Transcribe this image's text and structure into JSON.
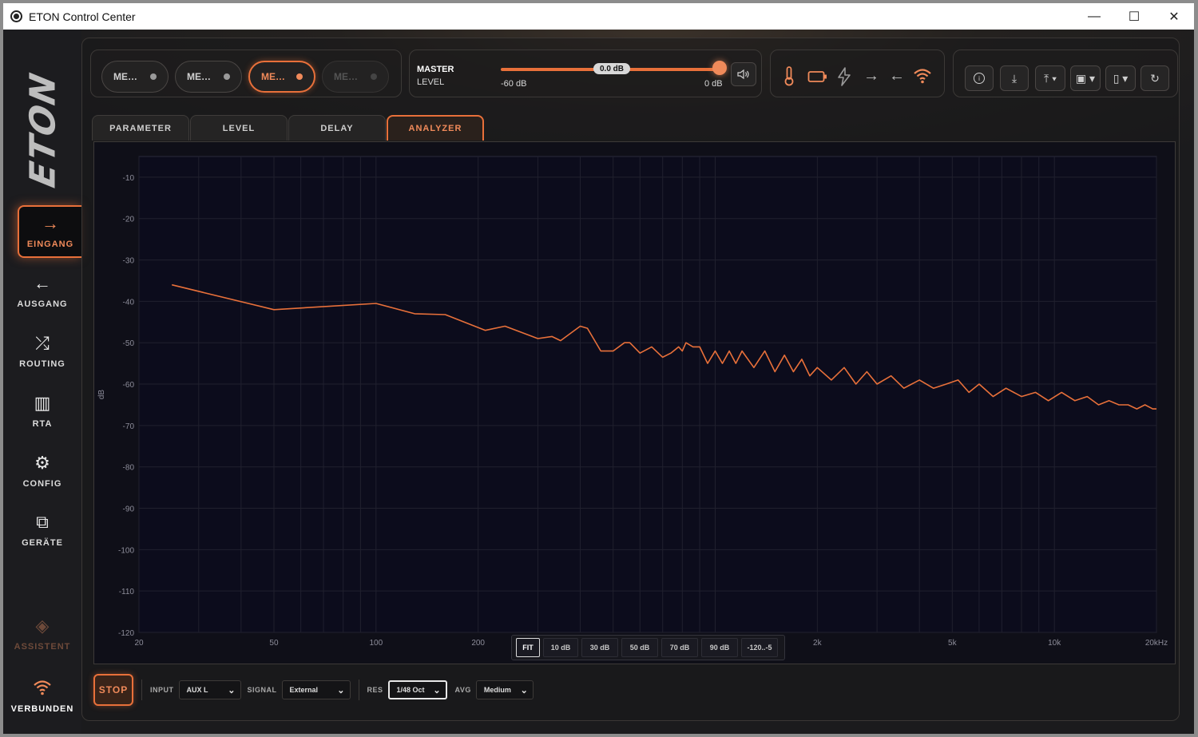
{
  "window": {
    "title": "ETON Control Center",
    "controls": {
      "minimize": "—",
      "maximize": "☐",
      "close": "✕"
    }
  },
  "sidebar": {
    "logo": "ETON",
    "items": [
      {
        "label": "EINGANG",
        "icon": "arrow-right-icon",
        "glyph": "→",
        "active": true
      },
      {
        "label": "AUSGANG",
        "icon": "arrow-left-icon",
        "glyph": "←"
      },
      {
        "label": "ROUTING",
        "icon": "shuffle-icon",
        "glyph": "⤮"
      },
      {
        "label": "RTA",
        "icon": "bar-chart-icon",
        "glyph": "▥"
      },
      {
        "label": "CONFIG",
        "icon": "gear-icon",
        "glyph": "⚙"
      },
      {
        "label": "GERÄTE",
        "icon": "devices-icon",
        "glyph": "⧉"
      },
      {
        "label": "ASSISTENT",
        "icon": "layers-icon",
        "glyph": "◈"
      },
      {
        "label": "VERBUNDEN",
        "icon": "wifi-icon",
        "glyph": "⌔"
      }
    ]
  },
  "memories": [
    {
      "label": "ME…"
    },
    {
      "label": "ME…"
    },
    {
      "label": "ME…",
      "active": true
    },
    {
      "label": "ME…",
      "disabled": true
    }
  ],
  "master": {
    "title": "MASTER",
    "subtitle": "LEVEL",
    "value": "0.0 dB",
    "min": "-60 dB",
    "max": "0 dB",
    "level_fraction": 1.0
  },
  "status_icons": [
    "thermometer-icon",
    "battery-icon",
    "bolt-icon",
    "arrow-right-icon",
    "arrow-left-icon",
    "wifi-icon"
  ],
  "toolbar_icons": [
    "info-icon",
    "download-icon",
    "upload-icon",
    "save-icon",
    "delete-icon",
    "refresh-icon"
  ],
  "tabs": [
    {
      "label": "PARAMETER"
    },
    {
      "label": "LEVEL"
    },
    {
      "label": "DELAY"
    },
    {
      "label": "ANALYZER",
      "active": true
    }
  ],
  "scale_buttons": [
    {
      "label": "FIT",
      "active": true
    },
    {
      "label": "10 dB"
    },
    {
      "label": "30 dB"
    },
    {
      "label": "50 dB"
    },
    {
      "label": "70 dB"
    },
    {
      "label": "90 dB"
    },
    {
      "label": "-120..-5"
    }
  ],
  "controls": {
    "stop": "STOP",
    "input_label": "INPUT",
    "input_value": "AUX L",
    "signal_label": "SIGNAL",
    "signal_value": "External",
    "res_label": "RES",
    "res_value": "1/48 Oct",
    "avg_label": "AVG",
    "avg_value": "Medium"
  },
  "chart_data": {
    "type": "line",
    "ylabel": "dB",
    "xlabel": "",
    "x_scale": "log",
    "xlim": [
      20,
      20000
    ],
    "ylim": [
      -120,
      -5
    ],
    "yticks": [
      -10,
      -20,
      -30,
      -40,
      -50,
      -60,
      -70,
      -80,
      -90,
      -100,
      -110,
      -120
    ],
    "xticks": [
      {
        "value": 20,
        "label": "20"
      },
      {
        "value": 50,
        "label": "50"
      },
      {
        "value": 100,
        "label": "100"
      },
      {
        "value": 200,
        "label": "200"
      },
      {
        "value": 2000,
        "label": "2k"
      },
      {
        "value": 5000,
        "label": "5k"
      },
      {
        "value": 10000,
        "label": "10k"
      },
      {
        "value": 20000,
        "label": "20kHz"
      }
    ],
    "grid": true,
    "series": [
      {
        "color": "#e8703a",
        "x": [
          25,
          50,
          100,
          130,
          160,
          210,
          240,
          300,
          330,
          350,
          400,
          420,
          460,
          500,
          540,
          560,
          600,
          650,
          700,
          740,
          780,
          800,
          820,
          860,
          900,
          950,
          1000,
          1050,
          1100,
          1150,
          1200,
          1300,
          1400,
          1500,
          1600,
          1700,
          1800,
          1900,
          2000,
          2200,
          2400,
          2600,
          2800,
          3000,
          3300,
          3600,
          4000,
          4400,
          4800,
          5200,
          5600,
          6000,
          6600,
          7200,
          8000,
          8800,
          9600,
          10500,
          11500,
          12500,
          13500,
          14500,
          15500,
          16500,
          17500,
          18500,
          19500,
          20000
        ],
        "y": [
          -36,
          -42,
          -40.5,
          -43,
          -43.2,
          -47,
          -46,
          -49,
          -48.5,
          -49.5,
          -46,
          -46.5,
          -52,
          -52,
          -50,
          -50,
          -52.5,
          -51,
          -53.5,
          -52.5,
          -51,
          -52,
          -50,
          -51,
          -51,
          -55,
          -52,
          -55,
          -52,
          -55,
          -52,
          -56,
          -52,
          -57,
          -53,
          -57,
          -54,
          -58,
          -56,
          -59,
          -56,
          -60,
          -57,
          -60,
          -58,
          -61,
          -59,
          -61,
          -60,
          -59,
          -62,
          -60,
          -63,
          -61,
          -63,
          -62,
          -64,
          -62,
          -64,
          -63,
          -65,
          -64,
          -65,
          -65,
          -66,
          -65,
          -66,
          -66
        ]
      }
    ]
  }
}
